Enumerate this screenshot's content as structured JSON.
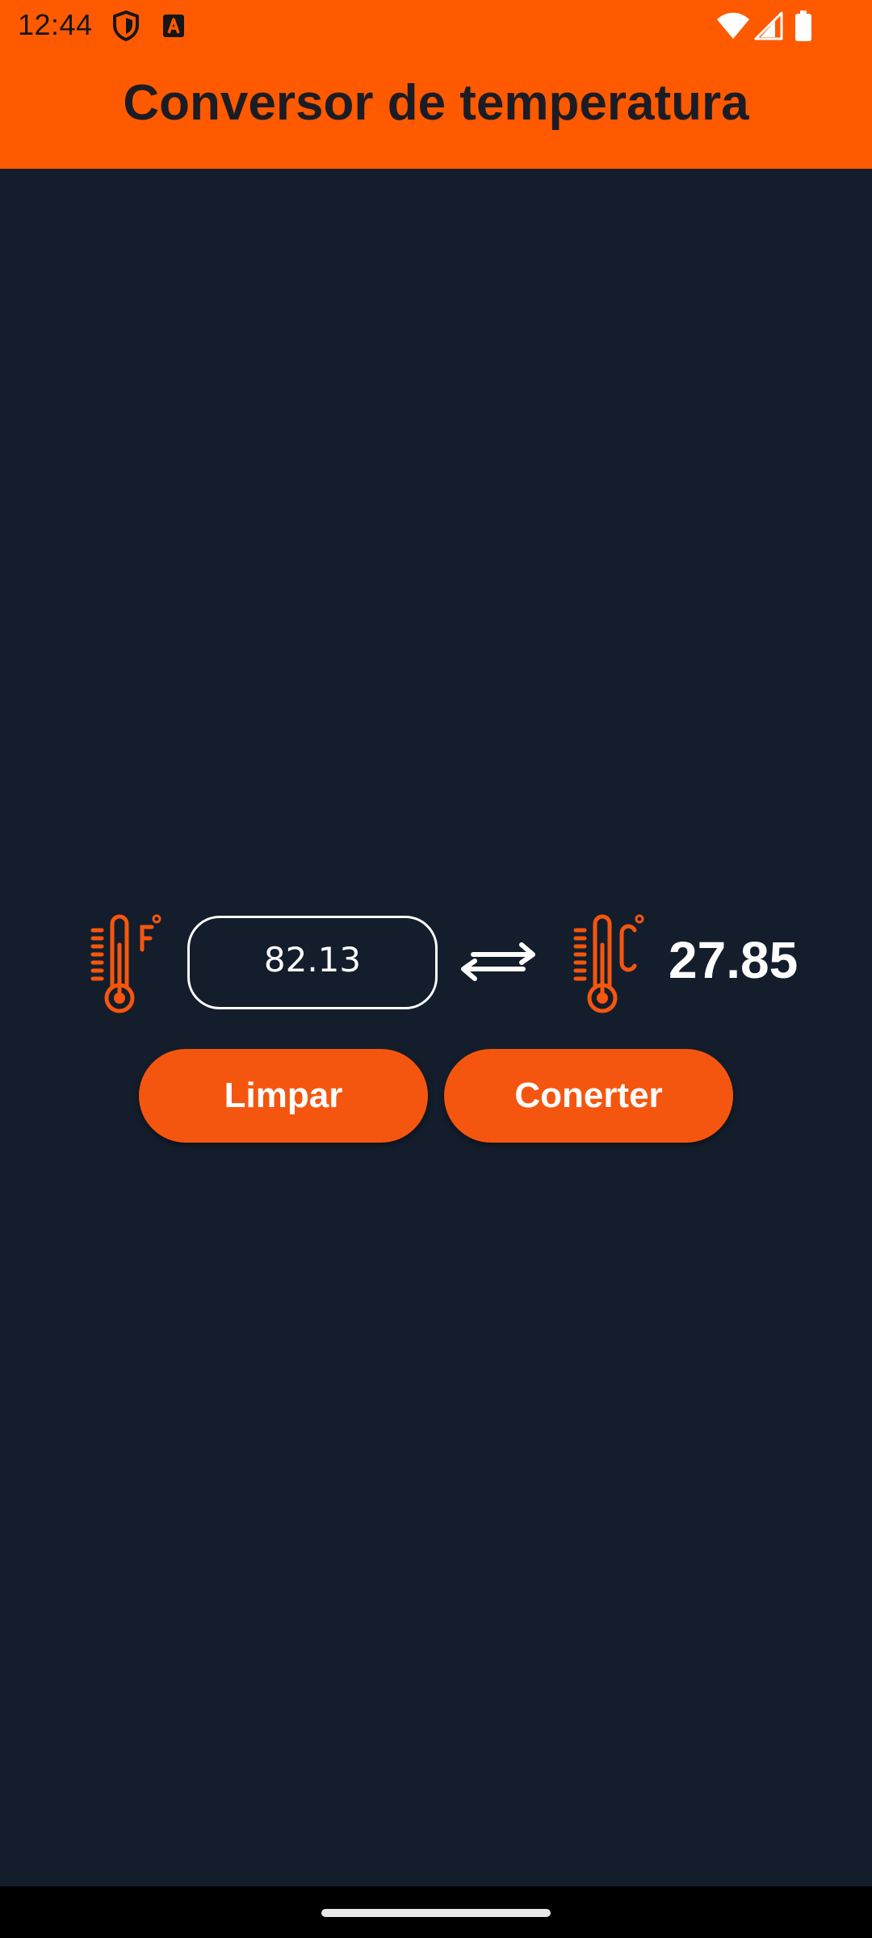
{
  "status_bar": {
    "time": "12:44",
    "left_icons": [
      "shield-icon",
      "a-notification-icon"
    ],
    "right_icons": [
      "wifi-icon",
      "signal-icon",
      "battery-icon"
    ]
  },
  "header": {
    "title": "Conversor de temperatura"
  },
  "converter": {
    "input_value": "82.13",
    "input_unit_icon": "thermometer-fahrenheit-icon",
    "swap_icon": "swap-arrows-icon",
    "output_unit_icon": "thermometer-celsius-icon",
    "result": "27.85"
  },
  "buttons": {
    "clear_label": "Limpar",
    "convert_label": "Conerter"
  },
  "colors": {
    "accent": "#ff5a00",
    "button": "#f5560f",
    "background": "#141d2b",
    "text_light": "#ffffff",
    "text_dark": "#1c1c24"
  }
}
